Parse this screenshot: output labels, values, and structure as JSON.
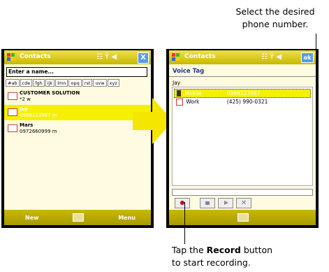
{
  "left_screen": {
    "title": "Contacts",
    "status_icons": "☷ Ÿ ◀",
    "close_label": "X",
    "search_placeholder": "Enter a name...",
    "tabs": [
      "#ab",
      "cde",
      "fgh",
      "ijk",
      "lmn",
      "opq",
      "rst",
      "uvw",
      "xyz"
    ],
    "contacts": [
      {
        "name": "CUSTOMER SOLUTION",
        "detail": "*2   w"
      },
      {
        "name": "Jay",
        "detail": "0988123987   m"
      },
      {
        "name": "Mars",
        "detail": "0972660999   m"
      }
    ],
    "softkey_left": "New",
    "softkey_right": "Menu"
  },
  "right_screen": {
    "title": "Contacts",
    "status_icons": "☷ Ÿ ◀",
    "ok_label": "ok",
    "heading": "Voice Tag",
    "contact_name": "Jay",
    "numbers": [
      {
        "label": "Mobile",
        "value": "0988123987"
      },
      {
        "label": "Work",
        "value": "(425) 990-0321"
      }
    ],
    "buttons": [
      "record",
      "stop",
      "play",
      "delete"
    ]
  },
  "callouts": {
    "top_line1": "Select the desired",
    "top_line2": "phone number.",
    "bottom_line1_pre": "Tap the ",
    "bottom_line1_bold": "Record",
    "bottom_line1_post": " button",
    "bottom_line2": "to start recording."
  },
  "colors": {
    "accent_yellow": "#f5f000",
    "title_gradient": "#c8b800"
  }
}
